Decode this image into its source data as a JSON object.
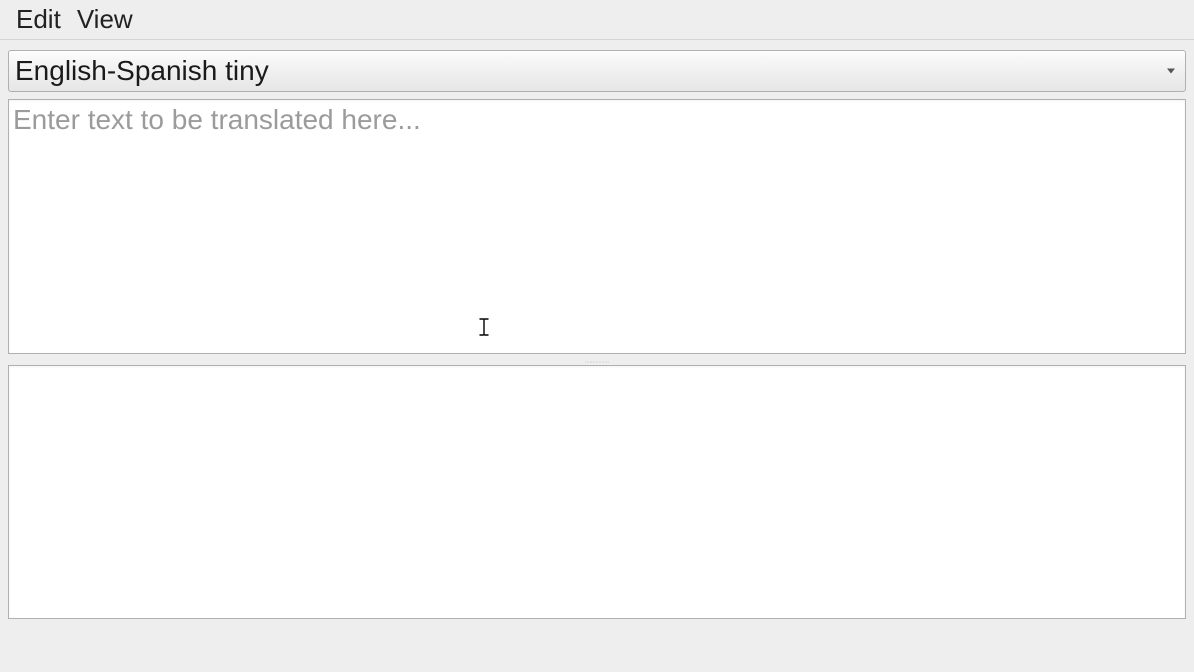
{
  "menubar": {
    "edit": "Edit",
    "view": "View"
  },
  "language_selector": {
    "selected": "English-Spanish tiny"
  },
  "input": {
    "placeholder": "Enter text to be translated here...",
    "value": ""
  },
  "output": {
    "value": ""
  }
}
